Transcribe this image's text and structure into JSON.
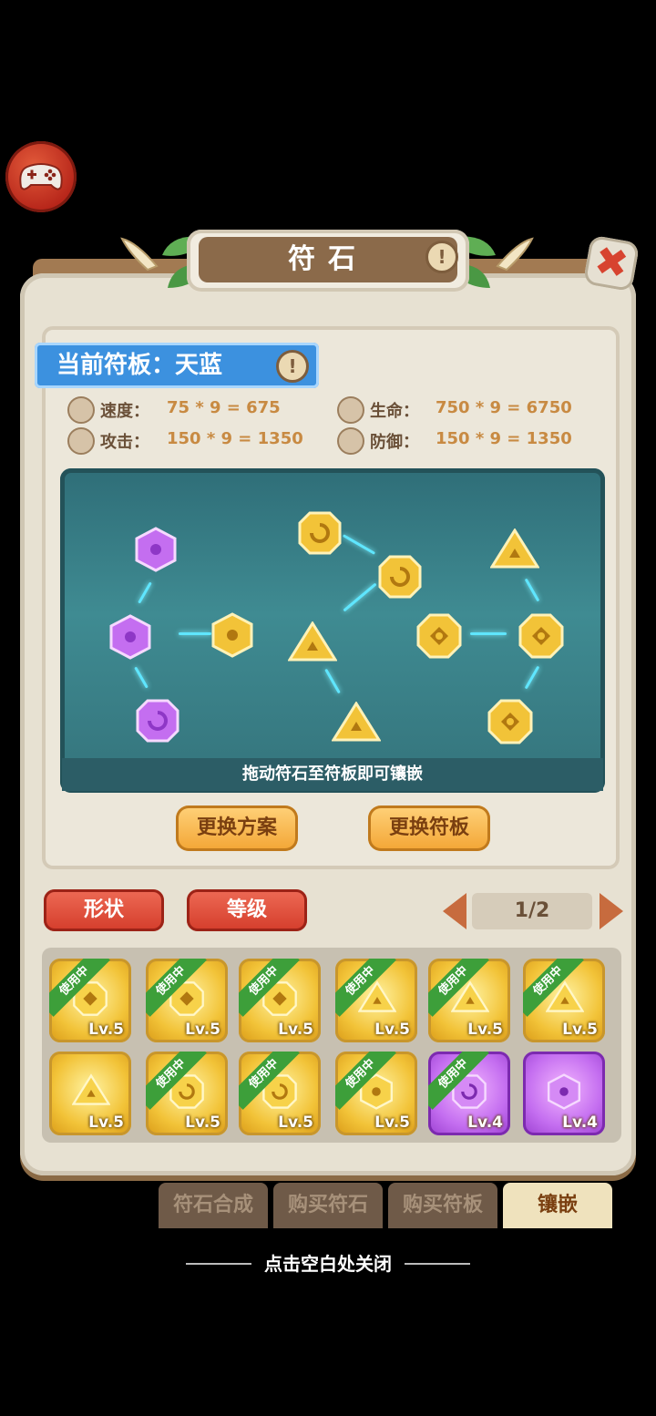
{
  "header": {
    "title": "符石",
    "close_label": "✖"
  },
  "current_board": {
    "label": "当前符板：天蓝",
    "stats": [
      {
        "name": "速度：",
        "value": "75 * 9 = 675"
      },
      {
        "name": "生命：",
        "value": "750 * 9 = 6750"
      },
      {
        "name": "攻击：",
        "value": "150 * 9 = 1350"
      },
      {
        "name": "防御：",
        "value": "150 * 9 = 1350"
      }
    ]
  },
  "board": {
    "caption": "拖动符石至符板即可镶嵌"
  },
  "actions": {
    "change_plan": "更换方案",
    "change_board": "更换符板"
  },
  "filters": {
    "shape": "形状",
    "level": "等级"
  },
  "pagination": {
    "current": "1/2"
  },
  "inventory": [
    {
      "color": "gold",
      "shape": "hex",
      "lv": "Lv.5",
      "in_use": "使用中"
    },
    {
      "color": "gold",
      "shape": "hex",
      "lv": "Lv.5",
      "in_use": "使用中"
    },
    {
      "color": "gold",
      "shape": "hex",
      "lv": "Lv.5",
      "in_use": "使用中"
    },
    {
      "color": "gold",
      "shape": "tri",
      "lv": "Lv.5",
      "in_use": "使用中"
    },
    {
      "color": "gold",
      "shape": "tri",
      "lv": "Lv.5",
      "in_use": "使用中"
    },
    {
      "color": "gold",
      "shape": "tri",
      "lv": "Lv.5",
      "in_use": "使用中"
    },
    {
      "color": "gold",
      "shape": "tri",
      "lv": "Lv.5",
      "in_use": ""
    },
    {
      "color": "gold",
      "shape": "swirl",
      "lv": "Lv.5",
      "in_use": "使用中"
    },
    {
      "color": "gold",
      "shape": "swirl",
      "lv": "Lv.5",
      "in_use": "使用中"
    },
    {
      "color": "gold",
      "shape": "dots",
      "lv": "Lv.5",
      "in_use": "使用中"
    },
    {
      "color": "purple",
      "shape": "swirl",
      "lv": "Lv.4",
      "in_use": "使用中"
    },
    {
      "color": "purple",
      "shape": "dots",
      "lv": "Lv.4",
      "in_use": ""
    }
  ],
  "tabs": [
    {
      "label": "符石合成"
    },
    {
      "label": "购买符石"
    },
    {
      "label": "购买符板"
    },
    {
      "label": "镶嵌",
      "active": true
    }
  ],
  "close_hint": "点击空白处关闭",
  "colors": {
    "gold": "#f2c338",
    "purple": "#c46ef0",
    "accent_blue": "#3c91df",
    "red": "#d43d2b"
  }
}
